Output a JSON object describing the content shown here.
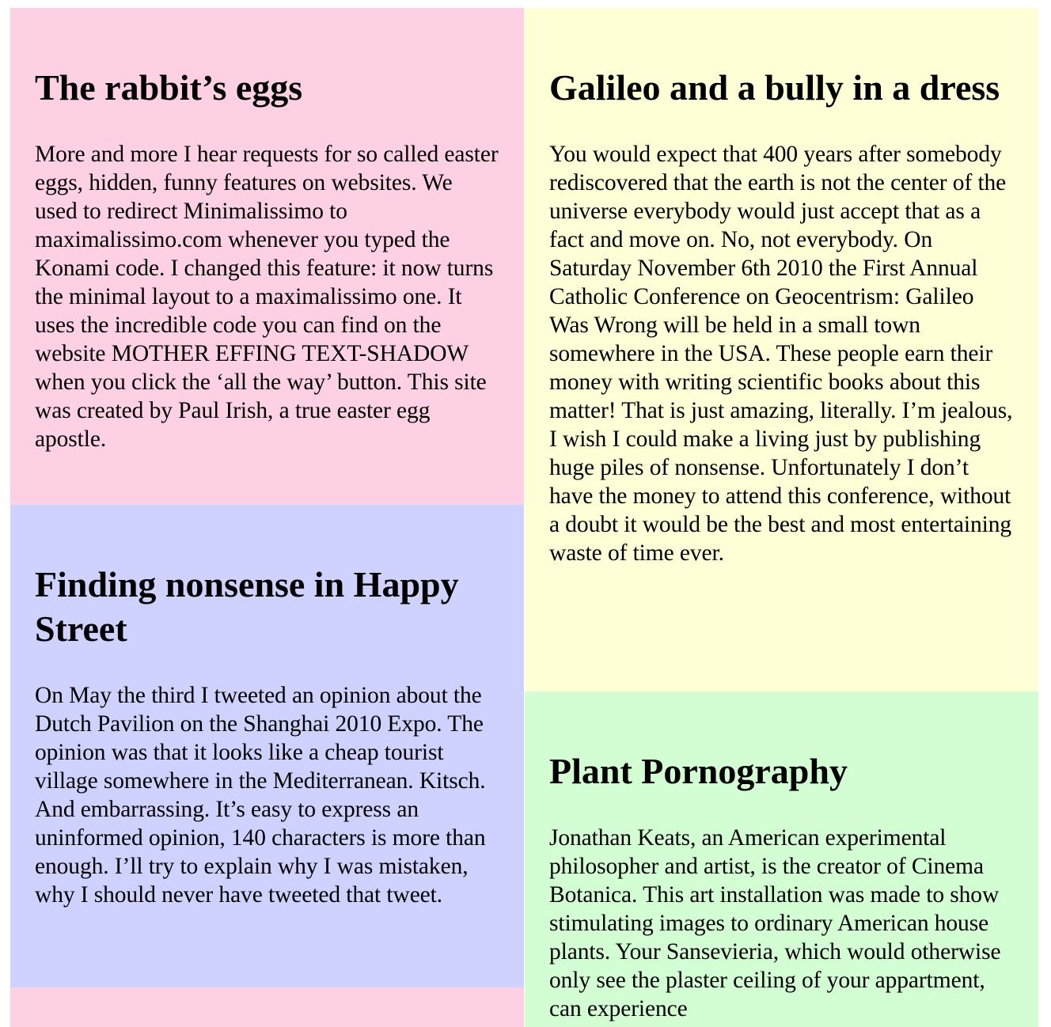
{
  "colors": {
    "pink": "#fdd0e4",
    "lavender": "#cfd2fe",
    "cream": "#fefed7",
    "mint": "#d3fed3"
  },
  "posts": {
    "rabbit": {
      "title": "The rabbit’s eggs",
      "body": "More and more I hear requests for so called easter eggs, hidden, funny features on websites. We used to redirect Minimalissimo to maximalissimo.com whenever you typed the Konami code. I changed this feature: it now turns the minimal layout to a maximalissimo one. It uses the incredible code you can find on the website MOTHER EFFING TEXT-SHADOW when you click the ‘all the way’ button. This site was created by Paul Irish, a true easter egg apostle."
    },
    "nonsense": {
      "title": "Finding nonsense in Happy Street",
      "body": "On May the third I tweeted an opinion about the Dutch Pavilion on the Shanghai 2010 Expo. The opinion was that it looks like a cheap tourist village somewhere in the Mediterranean. Kitsch. And embarrassing. It’s easy to express an uninformed opinion, 140 characters is more than enough. I’ll try to explain why I was mistaken, why I should never have tweeted that tweet."
    },
    "galileo": {
      "title": "Galileo and a bully in a dress",
      "body": "You would expect that 400 years after somebody rediscovered that the earth is not the center of the universe everybody would just accept that as a fact and move on. No, not everybody. On Saturday November 6th 2010 the First Annual Catholic Conference on Geocentrism: Galileo Was Wrong will be held in a small town somewhere in the USA. These people earn their money with writing scientific books about this matter! That is just amazing, literally. I’m jealous, I wish I could make a living just by publishing huge piles of nonsense. Unfortunately I don’t have the money to attend this conference, without a doubt it would be the best and most entertaining waste of time ever."
    },
    "plant": {
      "title": "Plant Pornography",
      "body": "Jonathan Keats, an American experimental philosopher and artist, is the creator of Cinema Botanica. This art installation was made to show stimulating images to ordinary American house plants. Your Sansevieria, which would otherwise only see the plaster ceiling of your appartment, can experience"
    }
  }
}
